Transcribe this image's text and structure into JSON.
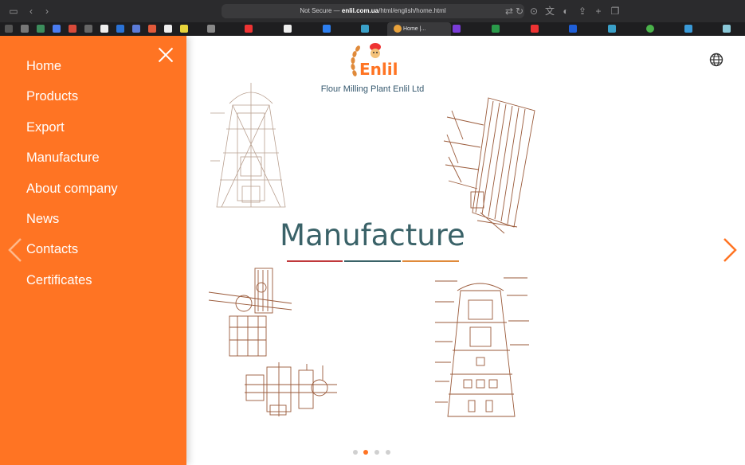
{
  "browser": {
    "address_prefix": "Not Secure — ",
    "address_domain": "enlil.com.ua",
    "address_path": "/html/english/home.html",
    "active_tab_title": "Home |..."
  },
  "menu": {
    "items": [
      {
        "label": "Home"
      },
      {
        "label": "Products"
      },
      {
        "label": "Export"
      },
      {
        "label": "Manufacture"
      },
      {
        "label": "About company"
      },
      {
        "label": "News"
      },
      {
        "label": "Contacts"
      },
      {
        "label": "Certificates"
      }
    ]
  },
  "header": {
    "logo_text": "Enlil",
    "tagline": "Flour Milling Plant Enlil Ltd"
  },
  "slider": {
    "title": "Manufacture",
    "slide_count": 4,
    "active_slide": 2
  },
  "colors": {
    "accent": "#ff7423",
    "title": "#3a6268",
    "tagline": "#35586e",
    "rule_red": "#c0393b",
    "rule_teal": "#3a6268",
    "rule_orange": "#e08a3a",
    "sketch": "#9a5a3a"
  },
  "icons": {
    "close": "close-icon",
    "prev": "chevron-left-icon",
    "next": "chevron-right-icon",
    "language": "globe-icon"
  }
}
